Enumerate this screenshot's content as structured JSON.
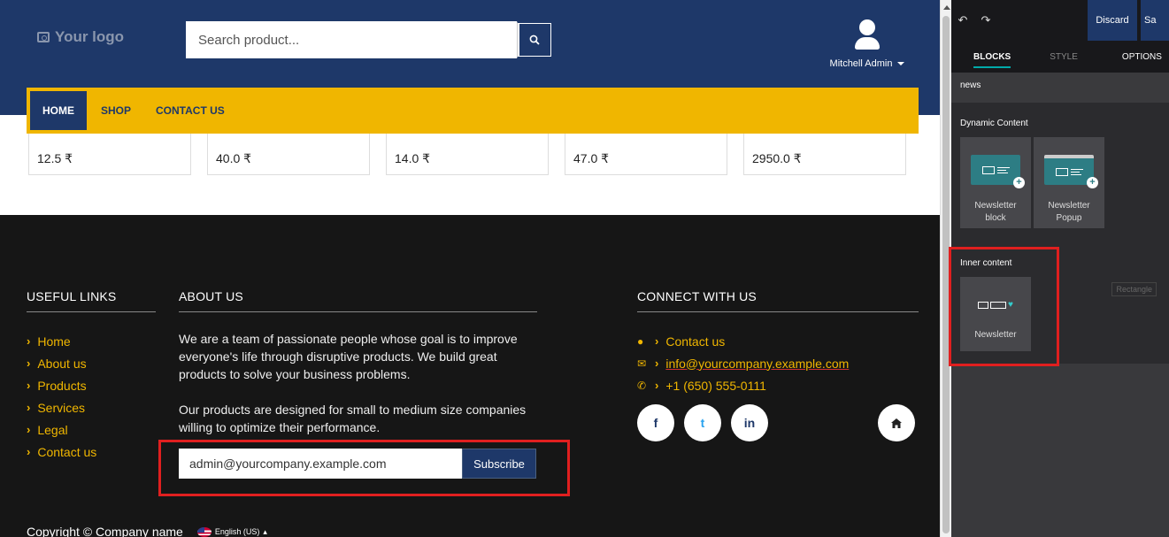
{
  "site": {
    "logo_text": "Your logo",
    "search": {
      "placeholder": "Search product..."
    },
    "user": {
      "name": "Mitchell Admin"
    },
    "nav": [
      {
        "label": "HOME",
        "active": true
      },
      {
        "label": "SHOP",
        "active": false
      },
      {
        "label": "CONTACT US",
        "active": false
      }
    ],
    "prices": [
      "12.5 ₹",
      "40.0 ₹",
      "14.0 ₹",
      "47.0 ₹",
      "2950.0 ₹"
    ],
    "footer": {
      "useful_links": {
        "title": "USEFUL LINKS",
        "items": [
          "Home",
          "About us",
          "Products",
          "Services",
          "Legal",
          "Contact us"
        ]
      },
      "about": {
        "title": "ABOUT US",
        "paragraph1": "We are a team of passionate people whose goal is to improve everyone's life through disruptive products. We build great products to solve your business problems.",
        "paragraph2": "Our products are designed for small to medium size companies willing to optimize their performance."
      },
      "subscribe": {
        "email_value": "admin@yourcompany.example.com",
        "button_label": "Subscribe"
      },
      "connect": {
        "title": "CONNECT WITH US",
        "items": [
          {
            "icon": "comment-icon",
            "label": "Contact us"
          },
          {
            "icon": "envelope-icon",
            "label": "info@yourcompany.example.com"
          },
          {
            "icon": "phone-icon",
            "label": "+1 (650) 555-0111"
          }
        ]
      },
      "social": [
        "f",
        "t",
        "in"
      ],
      "copyright": "Copyright © Company name",
      "language": "English (US)"
    },
    "colors": {
      "primary": "#1e3869",
      "accent": "#f0b600",
      "footer_bg": "#161616",
      "highlight": "#e01f1f"
    }
  },
  "editor": {
    "discard_label": "Discard",
    "save_label": "Sa",
    "tabs": [
      "BLOCKS",
      "STYLE",
      "OPTIONS"
    ],
    "search_value": "news",
    "dynamic_content": {
      "title": "Dynamic Content",
      "blocks": [
        "Newsletter block",
        "Newsletter Popup"
      ]
    },
    "inner_content": {
      "title": "Inner content",
      "blocks": [
        "Newsletter"
      ],
      "hint": "Rectangle"
    }
  }
}
